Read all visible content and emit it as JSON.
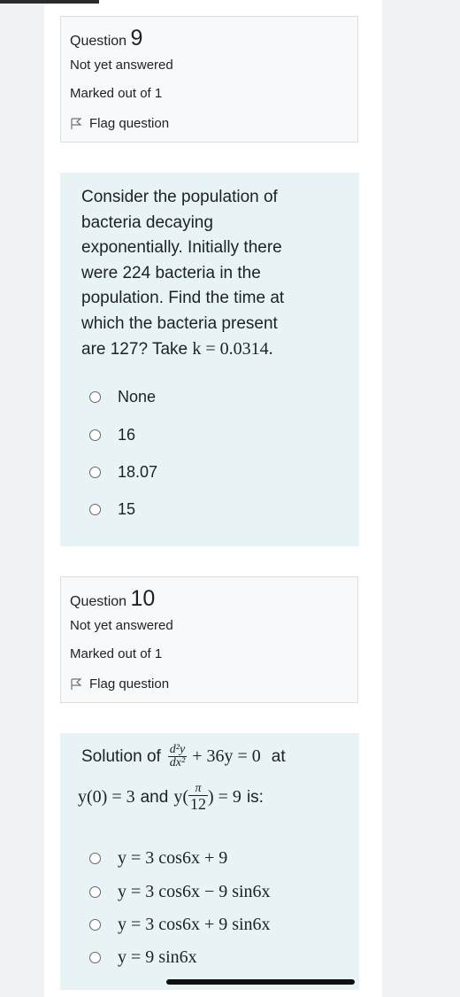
{
  "q9": {
    "label": "Question",
    "number": "9",
    "status": "Not yet answered",
    "marked": "Marked out of 1",
    "flag": "Flag question",
    "text_lines": [
      "Consider the population of",
      "bacteria decaying",
      "exponentially. Initially there",
      "were 224 bacteria in the",
      "population. Find the time at",
      "which the bacteria present"
    ],
    "text_last_prefix": "are 127? Take",
    "k_expr": "k = 0.0314.",
    "options": [
      "None",
      "16",
      "18.07",
      "15"
    ]
  },
  "q10": {
    "label": "Question",
    "number": "10",
    "status": "Not yet answered",
    "marked": "Marked out of 1",
    "flag": "Flag question",
    "solution_of": "Solution of",
    "deq_num": "d²y",
    "deq_den": "dx²",
    "deq_rest": "+ 36y = 0",
    "at": "at",
    "ic1": "y(0) = 3",
    "and": "and",
    "ic2_prefix": "y(",
    "pi_num": "π",
    "pi_den": "12",
    "ic2_suffix": ") = 9",
    "is": "is:",
    "options": [
      "y = 3 cos6x + 9",
      "y = 3 cos6x − 9 sin6x",
      "y = 3 cos6x + 9 sin6x",
      "y = 9 sin6x"
    ]
  }
}
